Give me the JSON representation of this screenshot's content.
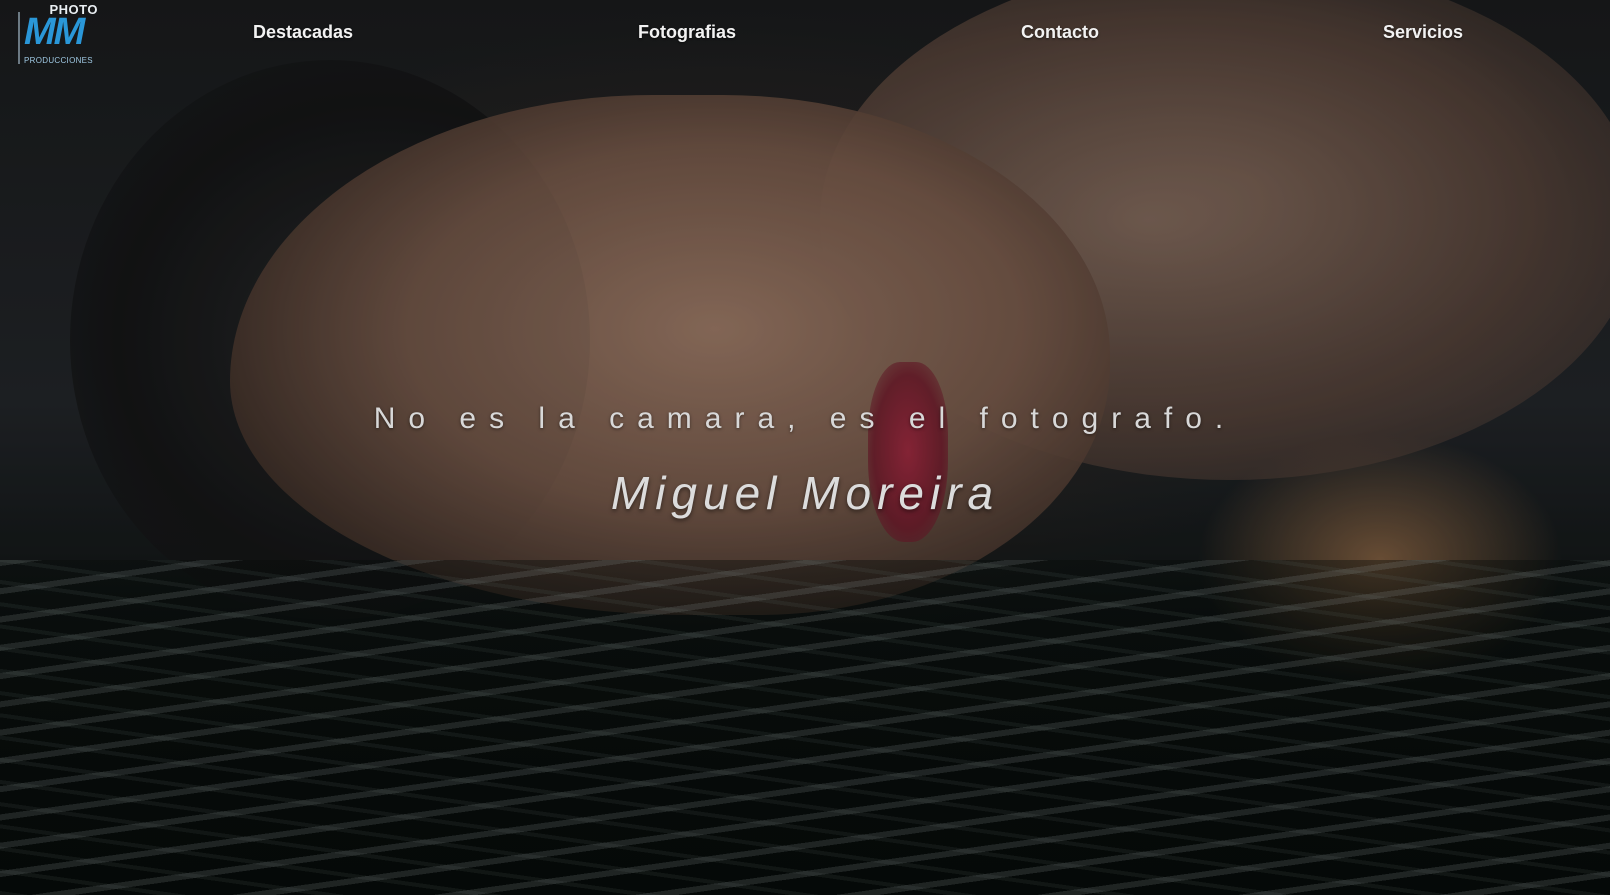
{
  "logo": {
    "top_text": "PHOTO",
    "mark_text": "MM",
    "bottom_text": "PRODUCCIONES",
    "color": "#2a97d8"
  },
  "nav": {
    "items": [
      {
        "label": "Destacadas"
      },
      {
        "label": "Fotografias"
      },
      {
        "label": "Contacto"
      },
      {
        "label": "Servicios"
      }
    ]
  },
  "hero": {
    "tagline": "No es la camara, es el fotografo.",
    "name": "Miguel Moreira",
    "image_description_icon": "portrait-photo"
  }
}
